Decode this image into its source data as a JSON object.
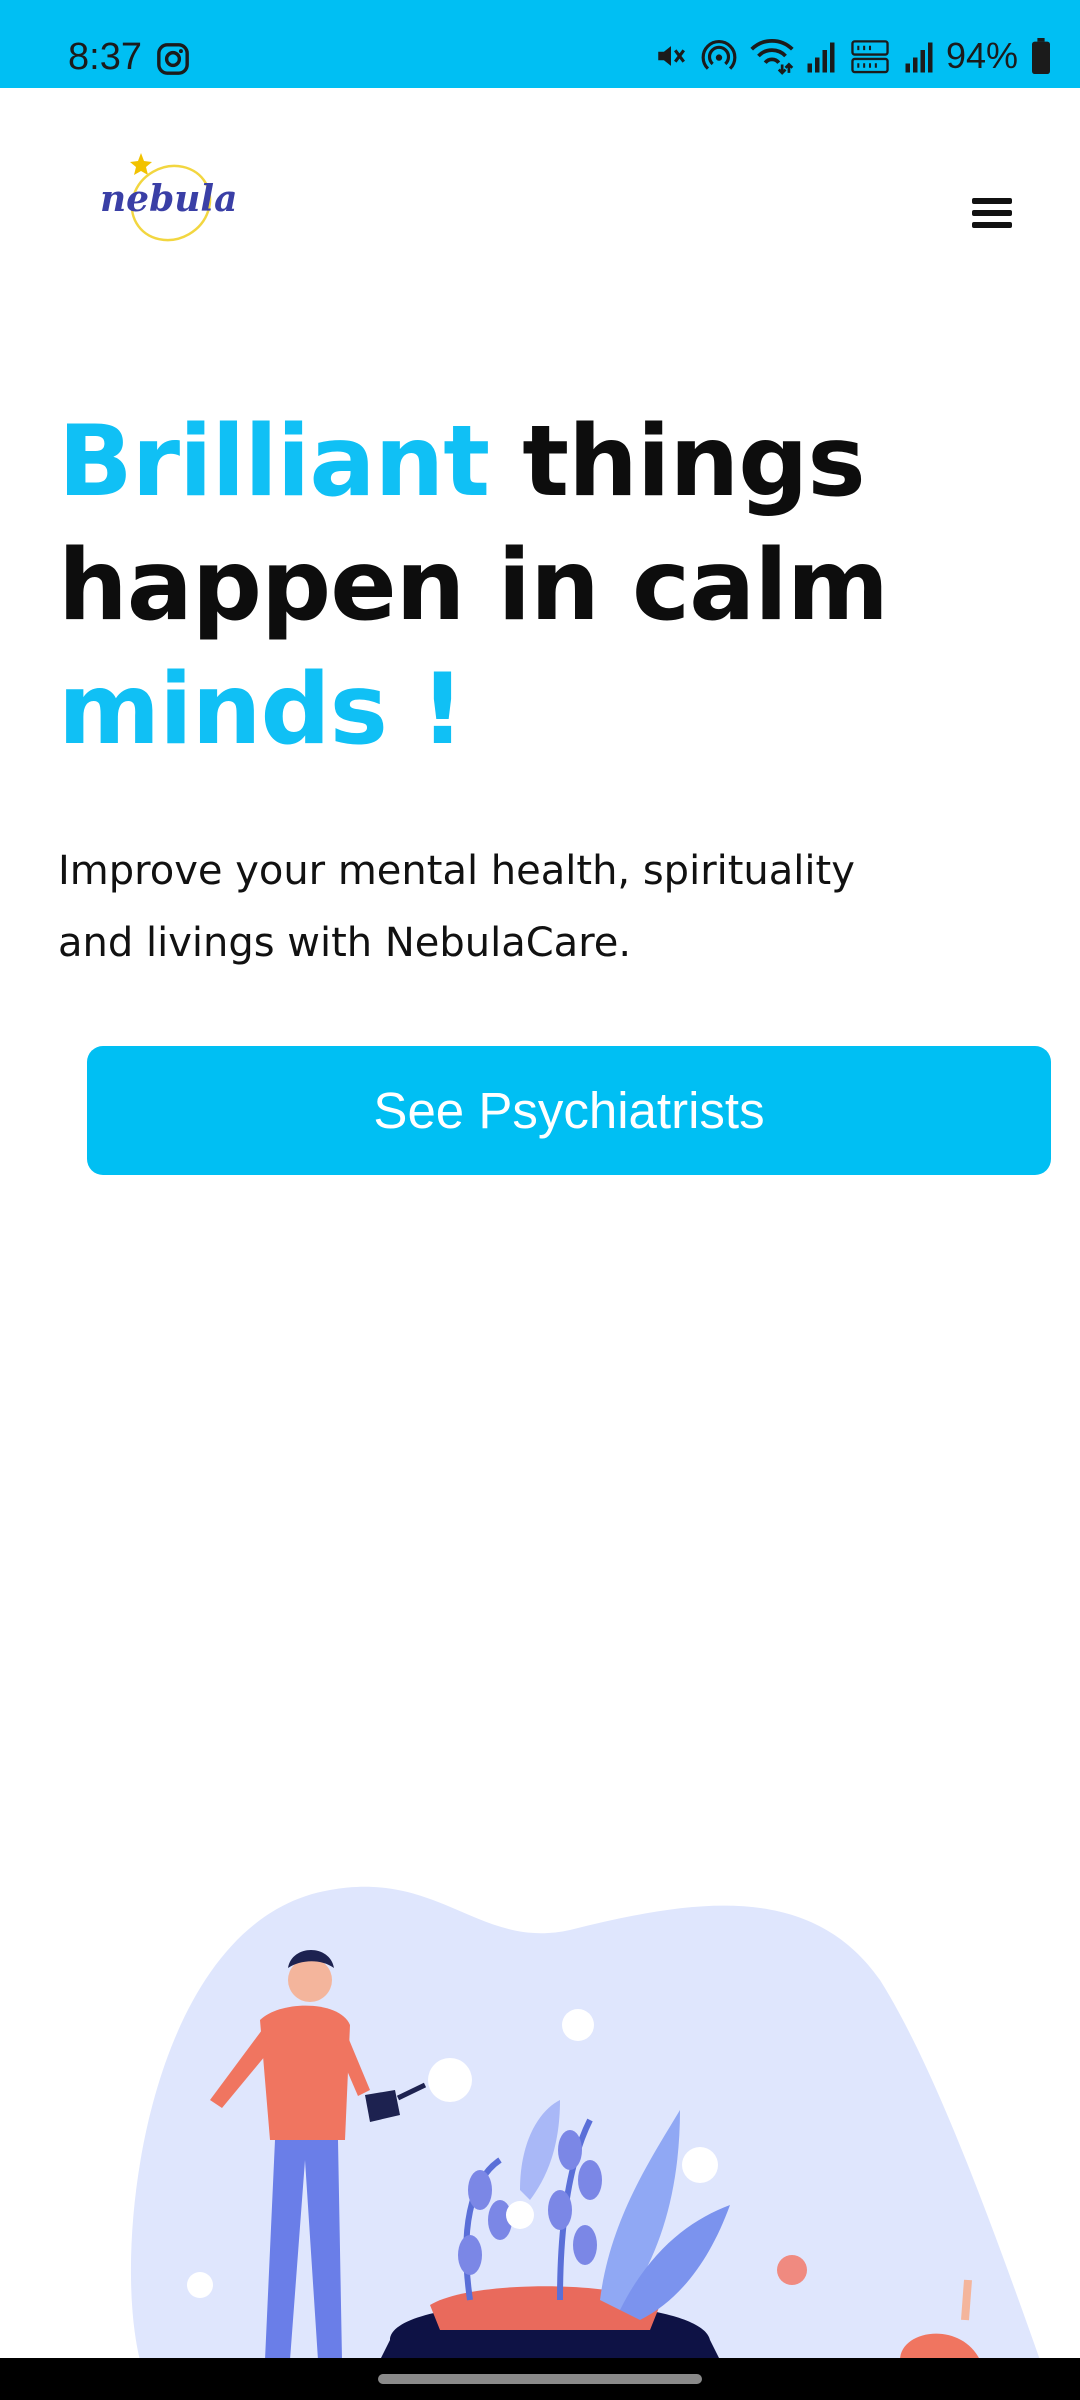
{
  "status_bar": {
    "time": "8:37",
    "battery_text": "94%",
    "icons": [
      "instagram-icon",
      "mute-icon",
      "hotspot-icon",
      "wifi-icon",
      "signal-icon",
      "volte-icon",
      "signal-icon",
      "battery-icon"
    ],
    "bg_color": "#00bff3"
  },
  "header": {
    "logo_text": "nebula",
    "menu_icon": "hamburger-menu-icon"
  },
  "hero": {
    "title_part1": "Brilliant",
    "title_part2": " things happen in calm ",
    "title_part3": "minds !",
    "subtitle": "Improve your mental health, spirituality and livings with NebulaCare.",
    "cta_label": "See Psychiatrists",
    "accent_color": "#10c0f5"
  },
  "illustration": {
    "icon": "man-watering-plants-illustration"
  }
}
